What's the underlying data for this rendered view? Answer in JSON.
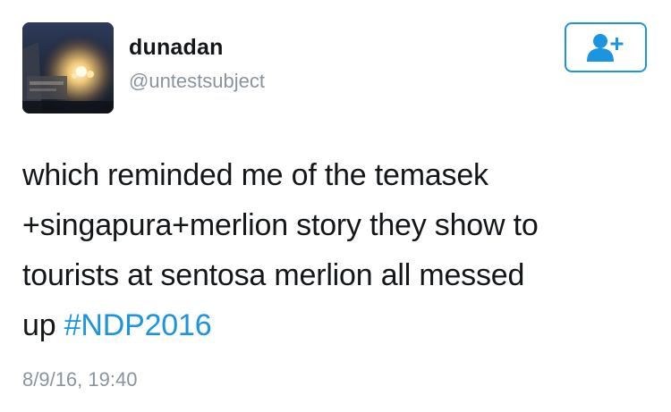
{
  "user": {
    "display_name": "dunadan",
    "handle": "@untestsubject"
  },
  "follow_button": {
    "icon": "follow-user-icon",
    "color": "#1b95e0"
  },
  "tweet": {
    "lines": [
      "which reminded me of the temasek",
      "+singapura+merlion story they show to",
      "tourists at sentosa merlion all messed"
    ],
    "last_line_prefix": "up ",
    "hashtag": "#NDP2016",
    "timestamp": "8/9/16, 19:40"
  },
  "colors": {
    "text": "#14171a",
    "secondary": "#8a949e",
    "link": "#1b95e0"
  }
}
